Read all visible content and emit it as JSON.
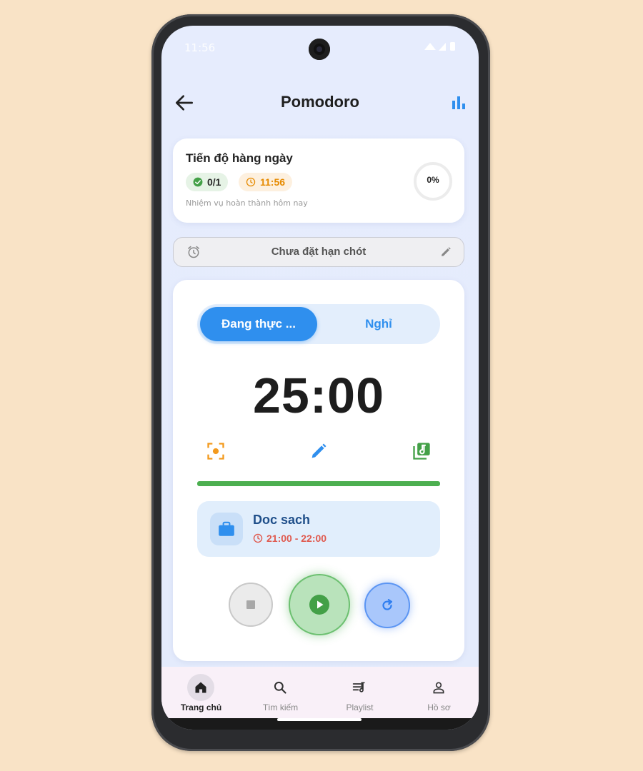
{
  "status_bar": {
    "time": "11:56"
  },
  "app_bar": {
    "title": "Pomodoro"
  },
  "daily_progress": {
    "title": "Tiến độ hàng ngày",
    "tasks_done": "0/1",
    "clock_time": "11:56",
    "subtitle": "Nhiệm vụ hoàn thành hôm nay",
    "percent_label": "0%",
    "percent_value": 0
  },
  "deadline": {
    "label": "Chưa đặt hạn chót"
  },
  "mode_toggle": {
    "focus_label": "Đang thực ...",
    "break_label": "Nghỉ",
    "selected": "focus"
  },
  "timer": {
    "display": "25:00",
    "progress_fraction": 1.0
  },
  "task": {
    "name": "Doc sach",
    "time_range": "21:00 - 22:00"
  },
  "nav": {
    "items": [
      {
        "label": "Trang chủ",
        "icon": "home-icon",
        "active": true
      },
      {
        "label": "Tìm kiếm",
        "icon": "search-icon",
        "active": false
      },
      {
        "label": "Playlist",
        "icon": "playlist-icon",
        "active": false
      },
      {
        "label": "Hồ sơ",
        "icon": "person-icon",
        "active": false
      }
    ]
  },
  "colors": {
    "accent": "#2f8fee",
    "progress": "#4caf50",
    "task_time": "#e05a4f",
    "warning": "#e68a00"
  }
}
